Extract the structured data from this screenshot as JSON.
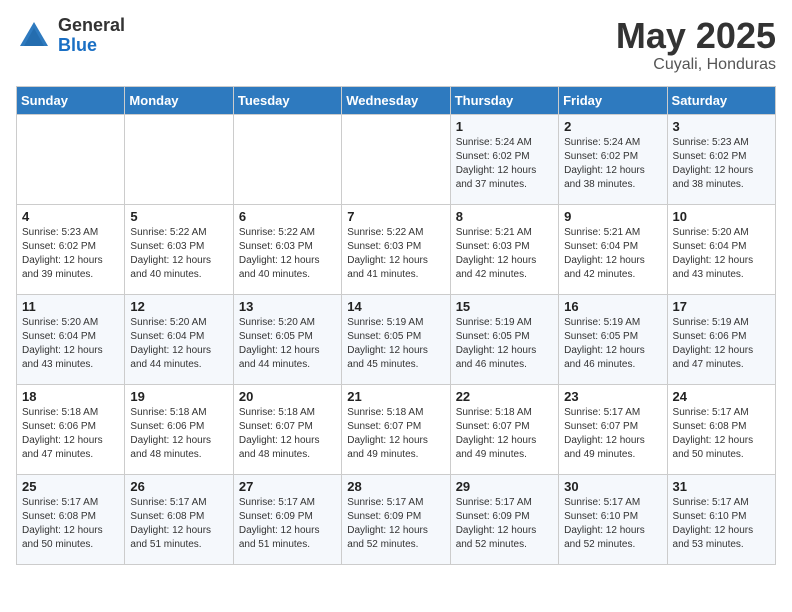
{
  "logo": {
    "general": "General",
    "blue": "Blue"
  },
  "title": "May 2025",
  "subtitle": "Cuyali, Honduras",
  "days_of_week": [
    "Sunday",
    "Monday",
    "Tuesday",
    "Wednesday",
    "Thursday",
    "Friday",
    "Saturday"
  ],
  "weeks": [
    [
      {
        "day": "",
        "detail": ""
      },
      {
        "day": "",
        "detail": ""
      },
      {
        "day": "",
        "detail": ""
      },
      {
        "day": "",
        "detail": ""
      },
      {
        "day": "1",
        "detail": "Sunrise: 5:24 AM\nSunset: 6:02 PM\nDaylight: 12 hours\nand 37 minutes."
      },
      {
        "day": "2",
        "detail": "Sunrise: 5:24 AM\nSunset: 6:02 PM\nDaylight: 12 hours\nand 38 minutes."
      },
      {
        "day": "3",
        "detail": "Sunrise: 5:23 AM\nSunset: 6:02 PM\nDaylight: 12 hours\nand 38 minutes."
      }
    ],
    [
      {
        "day": "4",
        "detail": "Sunrise: 5:23 AM\nSunset: 6:02 PM\nDaylight: 12 hours\nand 39 minutes."
      },
      {
        "day": "5",
        "detail": "Sunrise: 5:22 AM\nSunset: 6:03 PM\nDaylight: 12 hours\nand 40 minutes."
      },
      {
        "day": "6",
        "detail": "Sunrise: 5:22 AM\nSunset: 6:03 PM\nDaylight: 12 hours\nand 40 minutes."
      },
      {
        "day": "7",
        "detail": "Sunrise: 5:22 AM\nSunset: 6:03 PM\nDaylight: 12 hours\nand 41 minutes."
      },
      {
        "day": "8",
        "detail": "Sunrise: 5:21 AM\nSunset: 6:03 PM\nDaylight: 12 hours\nand 42 minutes."
      },
      {
        "day": "9",
        "detail": "Sunrise: 5:21 AM\nSunset: 6:04 PM\nDaylight: 12 hours\nand 42 minutes."
      },
      {
        "day": "10",
        "detail": "Sunrise: 5:20 AM\nSunset: 6:04 PM\nDaylight: 12 hours\nand 43 minutes."
      }
    ],
    [
      {
        "day": "11",
        "detail": "Sunrise: 5:20 AM\nSunset: 6:04 PM\nDaylight: 12 hours\nand 43 minutes."
      },
      {
        "day": "12",
        "detail": "Sunrise: 5:20 AM\nSunset: 6:04 PM\nDaylight: 12 hours\nand 44 minutes."
      },
      {
        "day": "13",
        "detail": "Sunrise: 5:20 AM\nSunset: 6:05 PM\nDaylight: 12 hours\nand 44 minutes."
      },
      {
        "day": "14",
        "detail": "Sunrise: 5:19 AM\nSunset: 6:05 PM\nDaylight: 12 hours\nand 45 minutes."
      },
      {
        "day": "15",
        "detail": "Sunrise: 5:19 AM\nSunset: 6:05 PM\nDaylight: 12 hours\nand 46 minutes."
      },
      {
        "day": "16",
        "detail": "Sunrise: 5:19 AM\nSunset: 6:05 PM\nDaylight: 12 hours\nand 46 minutes."
      },
      {
        "day": "17",
        "detail": "Sunrise: 5:19 AM\nSunset: 6:06 PM\nDaylight: 12 hours\nand 47 minutes."
      }
    ],
    [
      {
        "day": "18",
        "detail": "Sunrise: 5:18 AM\nSunset: 6:06 PM\nDaylight: 12 hours\nand 47 minutes."
      },
      {
        "day": "19",
        "detail": "Sunrise: 5:18 AM\nSunset: 6:06 PM\nDaylight: 12 hours\nand 48 minutes."
      },
      {
        "day": "20",
        "detail": "Sunrise: 5:18 AM\nSunset: 6:07 PM\nDaylight: 12 hours\nand 48 minutes."
      },
      {
        "day": "21",
        "detail": "Sunrise: 5:18 AM\nSunset: 6:07 PM\nDaylight: 12 hours\nand 49 minutes."
      },
      {
        "day": "22",
        "detail": "Sunrise: 5:18 AM\nSunset: 6:07 PM\nDaylight: 12 hours\nand 49 minutes."
      },
      {
        "day": "23",
        "detail": "Sunrise: 5:17 AM\nSunset: 6:07 PM\nDaylight: 12 hours\nand 49 minutes."
      },
      {
        "day": "24",
        "detail": "Sunrise: 5:17 AM\nSunset: 6:08 PM\nDaylight: 12 hours\nand 50 minutes."
      }
    ],
    [
      {
        "day": "25",
        "detail": "Sunrise: 5:17 AM\nSunset: 6:08 PM\nDaylight: 12 hours\nand 50 minutes."
      },
      {
        "day": "26",
        "detail": "Sunrise: 5:17 AM\nSunset: 6:08 PM\nDaylight: 12 hours\nand 51 minutes."
      },
      {
        "day": "27",
        "detail": "Sunrise: 5:17 AM\nSunset: 6:09 PM\nDaylight: 12 hours\nand 51 minutes."
      },
      {
        "day": "28",
        "detail": "Sunrise: 5:17 AM\nSunset: 6:09 PM\nDaylight: 12 hours\nand 52 minutes."
      },
      {
        "day": "29",
        "detail": "Sunrise: 5:17 AM\nSunset: 6:09 PM\nDaylight: 12 hours\nand 52 minutes."
      },
      {
        "day": "30",
        "detail": "Sunrise: 5:17 AM\nSunset: 6:10 PM\nDaylight: 12 hours\nand 52 minutes."
      },
      {
        "day": "31",
        "detail": "Sunrise: 5:17 AM\nSunset: 6:10 PM\nDaylight: 12 hours\nand 53 minutes."
      }
    ]
  ]
}
